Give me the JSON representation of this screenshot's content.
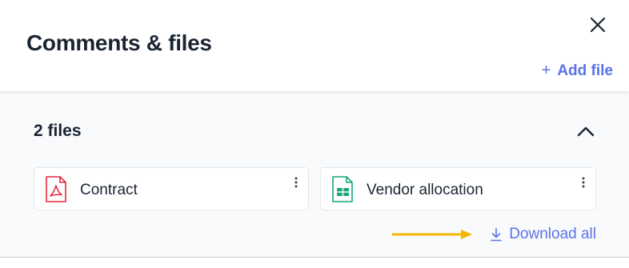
{
  "panel": {
    "title": "Comments & files",
    "add_file_label": "Add file",
    "add_file_icon": "plus-icon",
    "close_icon": "close-icon"
  },
  "files_section": {
    "title": "2 files",
    "collapse_icon": "chevron-up-icon",
    "files": [
      {
        "name": "Contract",
        "type": "pdf",
        "icon": "pdf-file-icon",
        "icon_color": "#e0283c"
      },
      {
        "name": "Vendor allocation",
        "type": "spreadsheet",
        "icon": "spreadsheet-file-icon",
        "icon_color": "#1aa774"
      }
    ],
    "download_all_label": "Download all",
    "download_icon": "download-icon"
  },
  "colors": {
    "accent": "#5b73e8",
    "annotation_arrow": "#f5b800",
    "text": "#1b2433"
  }
}
